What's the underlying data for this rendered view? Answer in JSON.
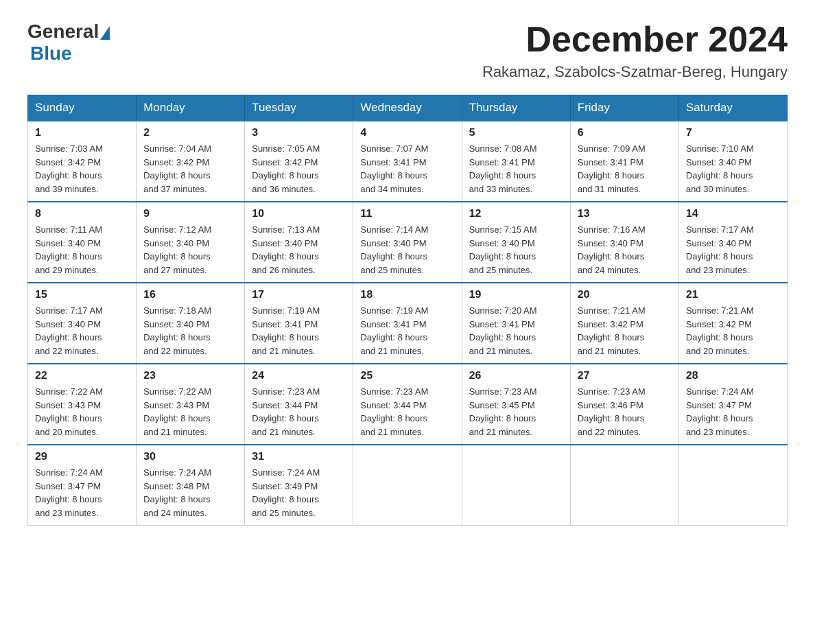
{
  "header": {
    "logo_general": "General",
    "logo_blue": "Blue",
    "month_title": "December 2024",
    "location": "Rakamaz, Szabolcs-Szatmar-Bereg, Hungary"
  },
  "days_of_week": [
    "Sunday",
    "Monday",
    "Tuesday",
    "Wednesday",
    "Thursday",
    "Friday",
    "Saturday"
  ],
  "weeks": [
    [
      {
        "day": "1",
        "sunrise": "7:03 AM",
        "sunset": "3:42 PM",
        "daylight": "8 hours and 39 minutes."
      },
      {
        "day": "2",
        "sunrise": "7:04 AM",
        "sunset": "3:42 PM",
        "daylight": "8 hours and 37 minutes."
      },
      {
        "day": "3",
        "sunrise": "7:05 AM",
        "sunset": "3:42 PM",
        "daylight": "8 hours and 36 minutes."
      },
      {
        "day": "4",
        "sunrise": "7:07 AM",
        "sunset": "3:41 PM",
        "daylight": "8 hours and 34 minutes."
      },
      {
        "day": "5",
        "sunrise": "7:08 AM",
        "sunset": "3:41 PM",
        "daylight": "8 hours and 33 minutes."
      },
      {
        "day": "6",
        "sunrise": "7:09 AM",
        "sunset": "3:41 PM",
        "daylight": "8 hours and 31 minutes."
      },
      {
        "day": "7",
        "sunrise": "7:10 AM",
        "sunset": "3:40 PM",
        "daylight": "8 hours and 30 minutes."
      }
    ],
    [
      {
        "day": "8",
        "sunrise": "7:11 AM",
        "sunset": "3:40 PM",
        "daylight": "8 hours and 29 minutes."
      },
      {
        "day": "9",
        "sunrise": "7:12 AM",
        "sunset": "3:40 PM",
        "daylight": "8 hours and 27 minutes."
      },
      {
        "day": "10",
        "sunrise": "7:13 AM",
        "sunset": "3:40 PM",
        "daylight": "8 hours and 26 minutes."
      },
      {
        "day": "11",
        "sunrise": "7:14 AM",
        "sunset": "3:40 PM",
        "daylight": "8 hours and 25 minutes."
      },
      {
        "day": "12",
        "sunrise": "7:15 AM",
        "sunset": "3:40 PM",
        "daylight": "8 hours and 25 minutes."
      },
      {
        "day": "13",
        "sunrise": "7:16 AM",
        "sunset": "3:40 PM",
        "daylight": "8 hours and 24 minutes."
      },
      {
        "day": "14",
        "sunrise": "7:17 AM",
        "sunset": "3:40 PM",
        "daylight": "8 hours and 23 minutes."
      }
    ],
    [
      {
        "day": "15",
        "sunrise": "7:17 AM",
        "sunset": "3:40 PM",
        "daylight": "8 hours and 22 minutes."
      },
      {
        "day": "16",
        "sunrise": "7:18 AM",
        "sunset": "3:40 PM",
        "daylight": "8 hours and 22 minutes."
      },
      {
        "day": "17",
        "sunrise": "7:19 AM",
        "sunset": "3:41 PM",
        "daylight": "8 hours and 21 minutes."
      },
      {
        "day": "18",
        "sunrise": "7:19 AM",
        "sunset": "3:41 PM",
        "daylight": "8 hours and 21 minutes."
      },
      {
        "day": "19",
        "sunrise": "7:20 AM",
        "sunset": "3:41 PM",
        "daylight": "8 hours and 21 minutes."
      },
      {
        "day": "20",
        "sunrise": "7:21 AM",
        "sunset": "3:42 PM",
        "daylight": "8 hours and 21 minutes."
      },
      {
        "day": "21",
        "sunrise": "7:21 AM",
        "sunset": "3:42 PM",
        "daylight": "8 hours and 20 minutes."
      }
    ],
    [
      {
        "day": "22",
        "sunrise": "7:22 AM",
        "sunset": "3:43 PM",
        "daylight": "8 hours and 20 minutes."
      },
      {
        "day": "23",
        "sunrise": "7:22 AM",
        "sunset": "3:43 PM",
        "daylight": "8 hours and 21 minutes."
      },
      {
        "day": "24",
        "sunrise": "7:23 AM",
        "sunset": "3:44 PM",
        "daylight": "8 hours and 21 minutes."
      },
      {
        "day": "25",
        "sunrise": "7:23 AM",
        "sunset": "3:44 PM",
        "daylight": "8 hours and 21 minutes."
      },
      {
        "day": "26",
        "sunrise": "7:23 AM",
        "sunset": "3:45 PM",
        "daylight": "8 hours and 21 minutes."
      },
      {
        "day": "27",
        "sunrise": "7:23 AM",
        "sunset": "3:46 PM",
        "daylight": "8 hours and 22 minutes."
      },
      {
        "day": "28",
        "sunrise": "7:24 AM",
        "sunset": "3:47 PM",
        "daylight": "8 hours and 23 minutes."
      }
    ],
    [
      {
        "day": "29",
        "sunrise": "7:24 AM",
        "sunset": "3:47 PM",
        "daylight": "8 hours and 23 minutes."
      },
      {
        "day": "30",
        "sunrise": "7:24 AM",
        "sunset": "3:48 PM",
        "daylight": "8 hours and 24 minutes."
      },
      {
        "day": "31",
        "sunrise": "7:24 AM",
        "sunset": "3:49 PM",
        "daylight": "8 hours and 25 minutes."
      },
      null,
      null,
      null,
      null
    ]
  ],
  "labels": {
    "sunrise": "Sunrise:",
    "sunset": "Sunset:",
    "daylight": "Daylight:"
  }
}
